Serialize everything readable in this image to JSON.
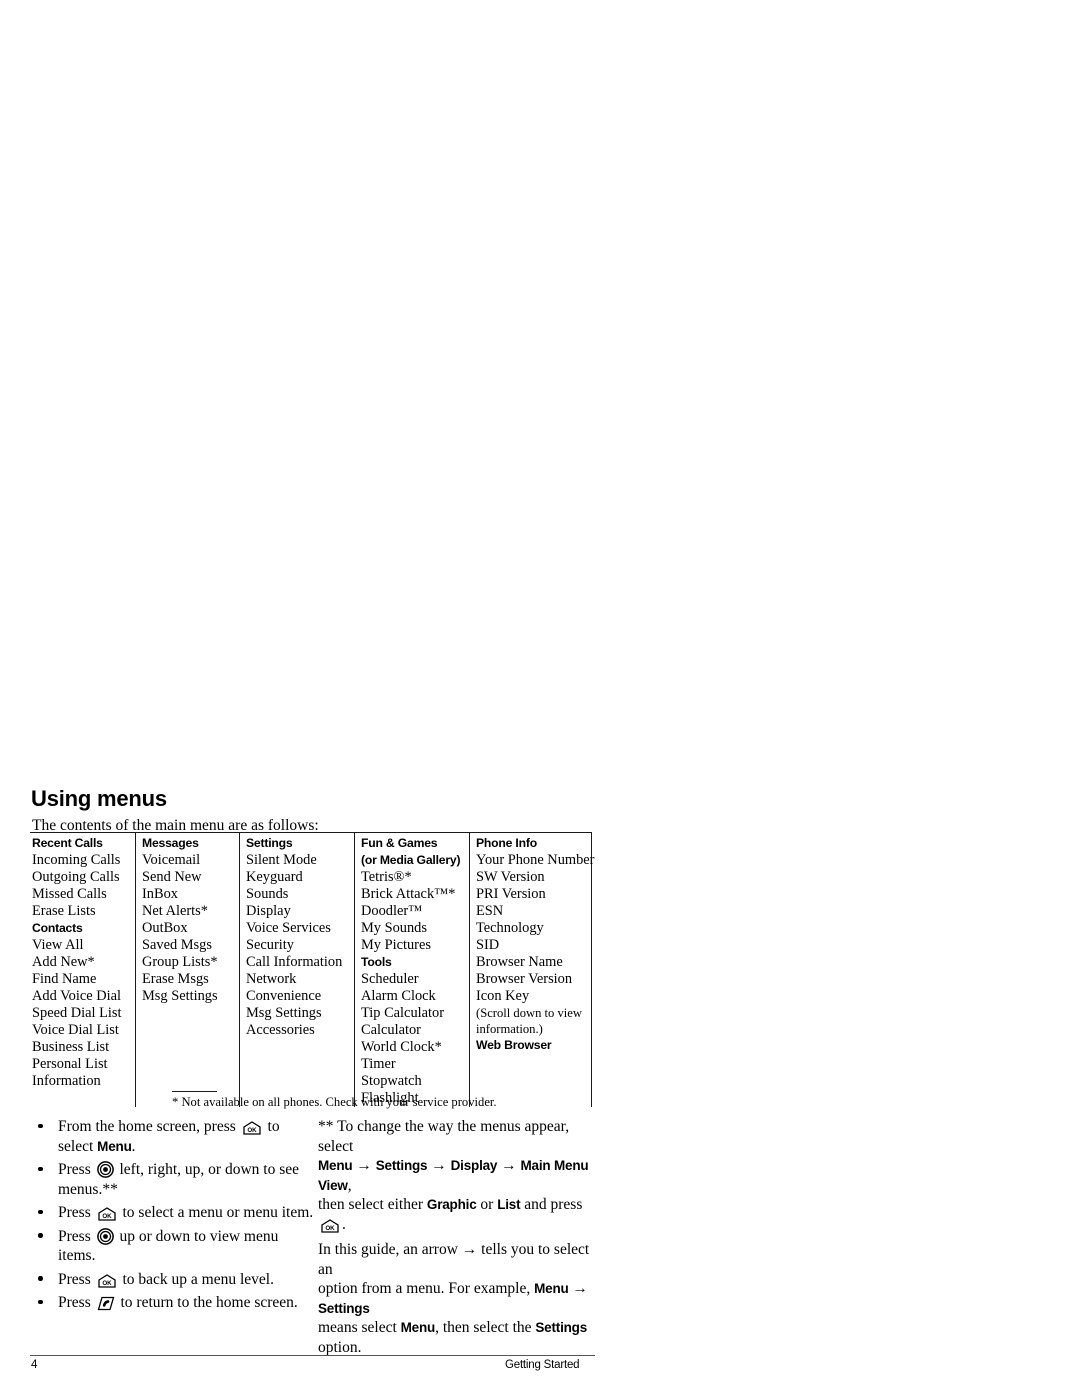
{
  "section": {
    "title": "Using menus",
    "intro": "The contents of the main menu are as follows:"
  },
  "menu_table": {
    "columns": [
      {
        "heading": "Recent Calls",
        "items": [
          "Incoming Calls",
          "Outgoing Calls",
          "Missed Calls",
          "Erase Lists"
        ],
        "subheading": "Contacts",
        "subitems": [
          "View All",
          "Add New*",
          "Find Name",
          "Add Voice Dial",
          "Speed Dial List",
          "Voice Dial List",
          "Business List",
          "Personal List",
          "Information"
        ]
      },
      {
        "heading": "Messages",
        "items": [
          "Voicemail",
          "Send New",
          "InBox",
          "Net Alerts*",
          "OutBox",
          "Saved Msgs",
          "Group Lists*",
          "Erase Msgs",
          "Msg Settings"
        ]
      },
      {
        "heading": "Settings",
        "items": [
          "Silent Mode",
          "Keyguard",
          "Sounds",
          "Display",
          "Voice Services",
          "Security",
          "Call Information",
          "Network",
          "Convenience",
          "Msg Settings",
          "Accessories"
        ]
      },
      {
        "heading": "Fun & Games",
        "heading2": "(or Media Gallery)",
        "items": [
          "Tetris®*",
          "Brick Attack™*",
          "Doodler™",
          "My Sounds",
          "My Pictures"
        ],
        "subheading": "Tools",
        "subitems": [
          "Scheduler",
          "Alarm Clock",
          "Tip Calculator",
          "Calculator",
          "World Clock*",
          "Timer",
          "Stopwatch",
          "Flashlight"
        ]
      },
      {
        "heading": "Phone Info",
        "items": [
          "Your Phone Number",
          "SW Version",
          "PRI Version",
          "ESN",
          "Technology",
          "SID",
          "Browser Name",
          "Browser Version",
          "Icon Key"
        ],
        "note1": "(Scroll down to view",
        "note2": "information.)",
        "subheading": "Web Browser"
      }
    ]
  },
  "footnote": "* Not available on all phones. Check with your service provider.",
  "bullets_left": [
    {
      "line1_a": "From the home screen, press ",
      "icon": "ok-key-icon",
      "line1_b": " to",
      "line2_a": "select ",
      "line2_bold": "Menu",
      "line2_b": "."
    },
    {
      "line1_a": "Press ",
      "icon": "navigation-ring-icon",
      "line1_b": " left, right, up, or down to see",
      "line2_a": "menus.**"
    },
    {
      "line1_a": "Press ",
      "icon": "ok-key-icon",
      "line1_b": " to select a menu or menu item."
    },
    {
      "line1_a": "Press ",
      "icon": "navigation-ring-icon",
      "line1_b": " up or down to view menu items."
    },
    {
      "line1_a": "Press ",
      "icon": "ok-key-icon",
      "line1_b": " to back up a menu level."
    },
    {
      "line1_a": "Press ",
      "icon": "end-call-key-icon",
      "line1_b": " to return to the home screen."
    }
  ],
  "right_column": {
    "p1_a": "** To change the way the menus appear, select",
    "p1_path": [
      "Menu",
      "Settings",
      "Display",
      "Main Menu View"
    ],
    "p1_trail": ",",
    "p1_b": "then select either ",
    "p1_opt1": "Graphic",
    "p1_mid": " or ",
    "p1_opt2": "List",
    "p1_c": " and press ",
    "p1_d": ".",
    "p2_a": "In this guide, an arrow → tells you to select an",
    "p2_b": "option from a menu. For example, ",
    "p2_bold1": "Menu",
    "p2_arrow": " → ",
    "p2_bold2": "Settings",
    "p2_c": "means select ",
    "p2_bold3": "Menu",
    "p2_d": ", then select the ",
    "p2_bold4": "Settings",
    "p2_e": " option."
  },
  "footer": {
    "page_number": "4",
    "chapter": "Getting Started"
  },
  "colors": {
    "text": "#000000",
    "rule": "#1a1a1a",
    "footer_rule": "#555555"
  }
}
